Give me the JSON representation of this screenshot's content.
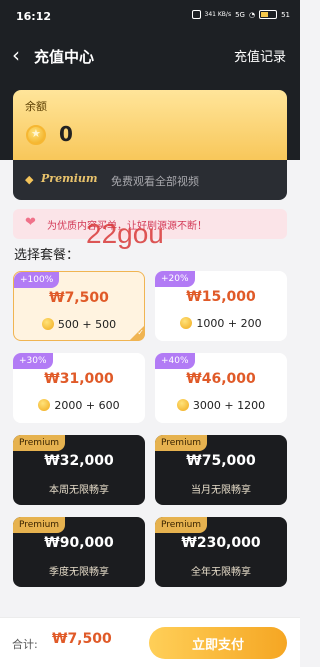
{
  "status_bar": {
    "time": "16:12",
    "network_speed": "341 KB/s",
    "signal": "5G",
    "battery": "51"
  },
  "nav": {
    "title": "充值中心",
    "record_link": "充值记录"
  },
  "balance": {
    "label": "余额",
    "value": "0"
  },
  "premium_bar": {
    "label": "Premium",
    "description": "免费观看全部视频"
  },
  "notice": {
    "text": "为优质内容买单，让好剧源源不断！"
  },
  "watermark": "22gou",
  "section_title": "选择套餐：",
  "packages": [
    {
      "tag": "+100%",
      "price": "₩7,500",
      "coins": "500 + 500",
      "selected": true
    },
    {
      "tag": "+20%",
      "price": "₩15,000",
      "coins": "1000 + 200"
    },
    {
      "tag": "+30%",
      "price": "₩31,000",
      "coins": "2000 + 600"
    },
    {
      "tag": "+40%",
      "price": "₩46,000",
      "coins": "3000 + 1200"
    }
  ],
  "premium_packages": [
    {
      "tag": "Premium",
      "price": "₩32,000",
      "desc": "本周无限畅享"
    },
    {
      "tag": "Premium",
      "price": "₩75,000",
      "desc": "当月无限畅享"
    },
    {
      "tag": "Premium",
      "price": "₩90,000",
      "desc": "季度无限畅享"
    },
    {
      "tag": "Premium",
      "price": "₩230,000",
      "desc": "全年无限畅享"
    }
  ],
  "bottom": {
    "total_label": "合计:",
    "total_value": "₩7,500",
    "pay_label": "立即支付"
  },
  "colors": {
    "accent": "#f5a623",
    "price": "#e05a28",
    "tag_purple": "#b27bf5",
    "dark_bg": "#1d2024"
  }
}
